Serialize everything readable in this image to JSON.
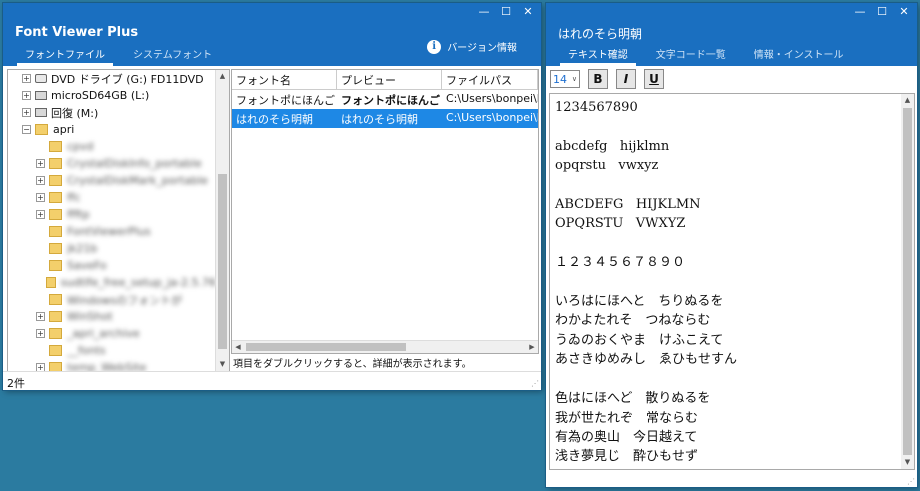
{
  "win1": {
    "title": "Font Viewer Plus",
    "tabs": [
      "フォントファイル",
      "システムフォント"
    ],
    "version_button": "バージョン情報",
    "tree": [
      {
        "label": "DVD ドライブ (G:) FD11DVD",
        "type": "dvd",
        "exp": "+",
        "blur": false
      },
      {
        "label": "microSD64GB (L:)",
        "type": "drive",
        "exp": "+",
        "blur": false
      },
      {
        "label": "回復 (M:)",
        "type": "drive",
        "exp": "+",
        "blur": false
      },
      {
        "label": "apri",
        "type": "folder",
        "exp": "−",
        "blur": false
      },
      {
        "label": "cpvd",
        "type": "folder",
        "exp": "",
        "blur": true
      },
      {
        "label": "CrystalDiskInfo_portable",
        "type": "folder",
        "exp": "+",
        "blur": true
      },
      {
        "label": "CrystalDiskMark_portable",
        "type": "folder",
        "exp": "+",
        "blur": true
      },
      {
        "label": "ffc",
        "type": "folder",
        "exp": "+",
        "blur": true
      },
      {
        "label": "ffftp",
        "type": "folder",
        "exp": "+",
        "blur": true
      },
      {
        "label": "FontViewerPlus",
        "type": "folder",
        "exp": "",
        "blur": true
      },
      {
        "label": "jk21b",
        "type": "folder",
        "exp": "",
        "blur": true
      },
      {
        "label": "SaveFo",
        "type": "folder",
        "exp": "",
        "blur": true
      },
      {
        "label": "sudtlfe_free_setup_ja-2.5.76",
        "type": "folder",
        "exp": "",
        "blur": true
      },
      {
        "label": "Windowsのフォントが",
        "type": "folder",
        "exp": "",
        "blur": true
      },
      {
        "label": "WinShot",
        "type": "folder",
        "exp": "+",
        "blur": true
      },
      {
        "label": "_apri_archive",
        "type": "folder",
        "exp": "+",
        "blur": true
      },
      {
        "label": "__fonts",
        "type": "folder",
        "exp": "",
        "blur": true
      },
      {
        "label": "temp_WebSite",
        "type": "folder",
        "exp": "+",
        "blur": true
      }
    ],
    "list_headers": [
      "フォント名",
      "プレビュー",
      "ファイルパス"
    ],
    "list_rows": [
      {
        "name": "フォントポにほんご",
        "preview": "フォントポにほんご",
        "path": "C:\\Users\\bonpei\\De",
        "selected": false
      },
      {
        "name": "はれのそら明朝",
        "preview": "はれのそら明朝",
        "path": "C:\\Users\\bonpei\\De",
        "selected": true
      }
    ],
    "hint": "項目をダブルクリックすると、詳細が表示されます。",
    "status": "2件"
  },
  "win2": {
    "title": "はれのそら明朝",
    "tabs": [
      "テキスト確認",
      "文字コード一覧",
      "情報・インストール"
    ],
    "font_size": "14",
    "bold_label": "B",
    "italic_label": "I",
    "underline_label": "U",
    "preview_text": "1234567890\n\nabcdefg   hijklmn\nopqrstu   vwxyz\n\nABCDEFG   HIJKLMN\nOPQRSTU   VWXYZ\n\n１２３４５６７８９０\n\nいろはにほへと　ちりぬるを\nわかよたれそ　つねならむ\nうゐのおくやま　けふこえて\nあさきゆめみし　ゑひもせすん\n\n色はにほへど　散りぬるを\n我が世たれぞ　常ならむ\n有為の奥山　今日越えて\n浅き夢見じ　酔ひもせず"
  },
  "colors": {
    "titlebar": "#1a6fc0",
    "selection": "#1e88e5",
    "desktop": "#2b7ba0"
  }
}
